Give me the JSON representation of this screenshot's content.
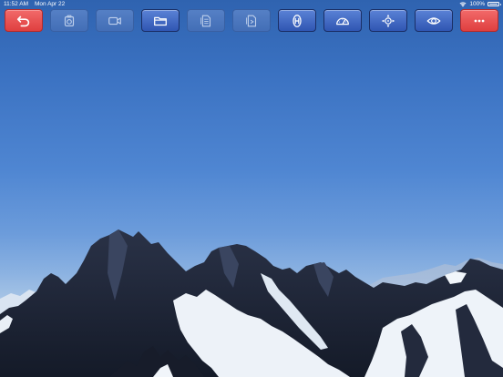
{
  "status_bar": {
    "time": "11:52 AM",
    "date": "Mon Apr 22",
    "battery": "100%"
  },
  "toolbar": {
    "buttons": [
      {
        "icon": "back-arrow-icon",
        "style": "red"
      },
      {
        "icon": "camera-icon",
        "style": "dim"
      },
      {
        "icon": "video-camera-icon",
        "style": "dim"
      },
      {
        "icon": "folder-icon",
        "style": "blue"
      },
      {
        "icon": "document-list-icon",
        "style": "dim"
      },
      {
        "icon": "document-export-icon",
        "style": "dim"
      },
      {
        "icon": "h-marker-icon",
        "style": "blue"
      },
      {
        "icon": "gauge-icon",
        "style": "blue"
      },
      {
        "icon": "compass-crosshair-icon",
        "style": "blue"
      },
      {
        "icon": "eye-icon",
        "style": "blue"
      },
      {
        "icon": "more-dots-icon",
        "style": "red"
      }
    ]
  },
  "colors": {
    "sky_top": "#2f63b0",
    "sky_bottom": "#d5e1ef",
    "button_blue": "#2f56b2",
    "button_red": "#df3f3f",
    "snow": "#eef3f8",
    "rock": "#1b2033"
  }
}
